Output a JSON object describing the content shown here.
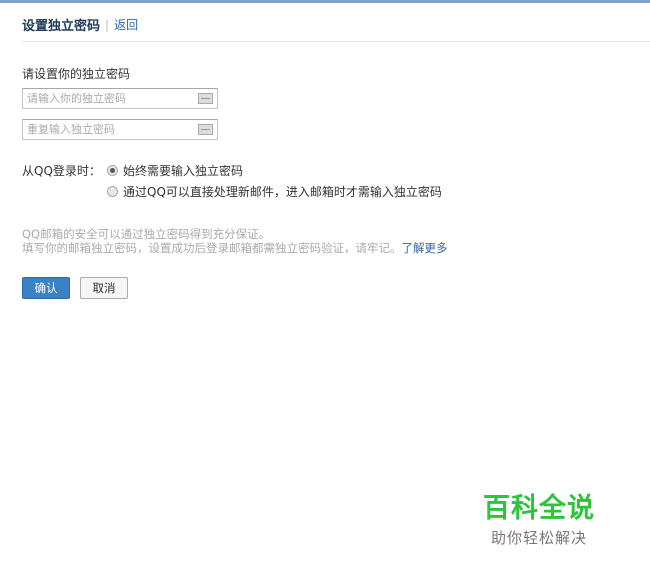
{
  "header": {
    "title": "设置独立密码",
    "separator": "|",
    "back": "返回"
  },
  "form": {
    "label": "请设置你的独立密码",
    "password_placeholder": "请输入你的独立密码",
    "confirm_placeholder": "重复输入独立密码",
    "login_label": "从QQ登录时：",
    "options": [
      "始终需要输入独立密码",
      "通过QQ可以直接处理新邮件，进入邮箱时才需输入独立密码"
    ],
    "selected_option": 0
  },
  "hint": {
    "line1": "QQ邮箱的安全可以通过独立密码得到充分保证。",
    "line2": "填写你的邮箱独立密码，设置成功后登录邮箱都需独立密码验证，请牢记。",
    "more": "了解更多"
  },
  "buttons": {
    "ok": "确认",
    "cancel": "取消"
  },
  "watermark": {
    "title": "百科全说",
    "subtitle": "助你轻松解决"
  }
}
